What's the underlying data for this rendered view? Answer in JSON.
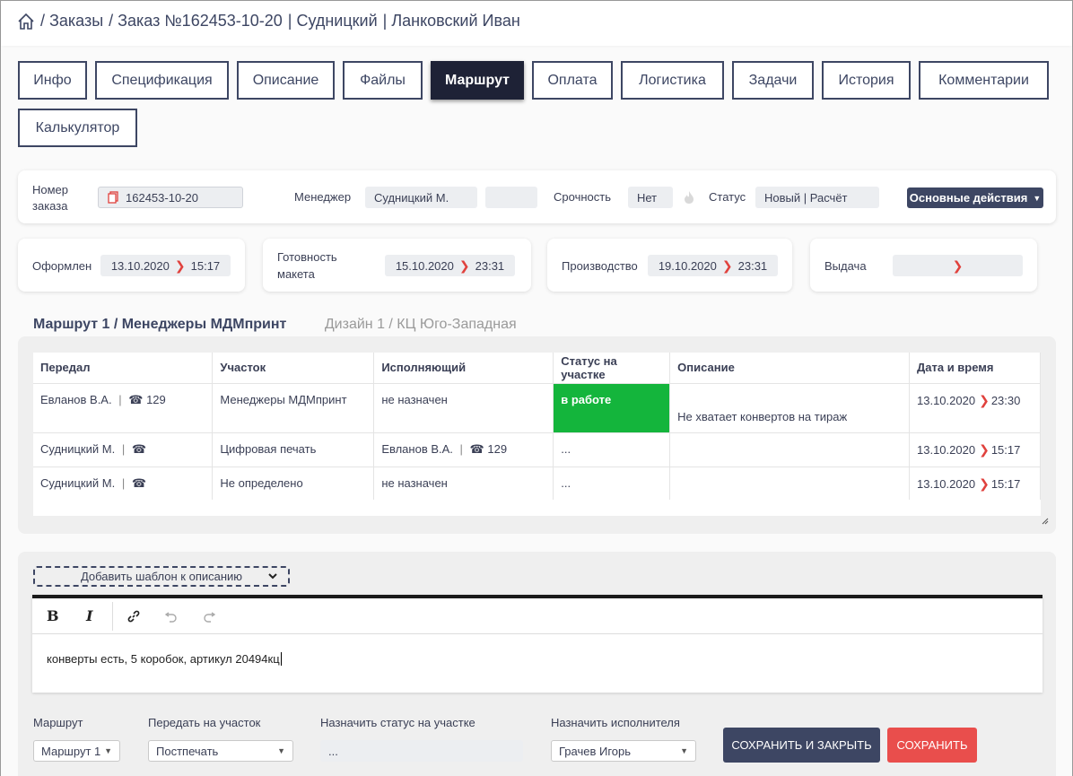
{
  "breadcrumb": {
    "orders": "/ Заказы",
    "order": "/ Заказ №162453-10-20",
    "manager": "| Судницкий",
    "client": "| Ланковский Иван"
  },
  "tabs": [
    "Инфо",
    "Спецификация",
    "Описание",
    "Файлы",
    "Маршрут",
    "Оплата",
    "Логистика",
    "Задачи",
    "История",
    "Комментарии",
    "Калькулятор"
  ],
  "active_tab": "Маршрут",
  "order_info": {
    "number_label": "Номер\nзаказа",
    "number_value": "162453-10-20",
    "manager_label": "Менеджер",
    "manager_value": "Судницкий М.",
    "urgency_label": "Срочность",
    "urgency_value": "Нет",
    "status_label": "Статус",
    "status_value": "Новый | Расчёт",
    "actions_button": "Основные действия"
  },
  "dates": {
    "placed_label": "Оформлен",
    "placed_date": "13.10.2020",
    "placed_time": "15:17",
    "layout_label": "Готовность\nмакета",
    "layout_date": "15.10.2020",
    "layout_time": "23:31",
    "production_label": "Производство",
    "production_date": "19.10.2020",
    "production_time": "23:31",
    "delivery_label": "Выдача"
  },
  "route_tabs": {
    "active": "Маршрут 1 / Менеджеры МДМпринт",
    "inactive": "Дизайн 1 / КЦ Юго-Западная"
  },
  "route_table": {
    "headers": [
      "Передал",
      "Участок",
      "Исполняющий",
      "Статус на участке",
      "Описание",
      "Дата и время"
    ],
    "rows": [
      {
        "from": "Евланов В.А.",
        "from_phone": "129",
        "section": "Менеджеры МДМпринт",
        "executor": "не назначен",
        "executor_phone": "",
        "status": "в работе",
        "description": "Не хватает конвертов на тираж",
        "date": "13.10.2020",
        "time": "23:30"
      },
      {
        "from": "Судницкий М.",
        "from_phone": "",
        "section": "Цифровая печать",
        "executor": "Евланов В.А.",
        "executor_phone": "129",
        "status": "...",
        "description": "",
        "date": "13.10.2020",
        "time": "15:17"
      },
      {
        "from": "Судницкий М.",
        "from_phone": "",
        "section": "Не определено",
        "executor": "не назначен",
        "executor_phone": "",
        "status": "...",
        "description": "",
        "date": "13.10.2020",
        "time": "15:17"
      }
    ]
  },
  "editor": {
    "template_select": "Добавить шаблон к описанию",
    "text": "конверты есть, 5 коробок, артикул 20494кц"
  },
  "form": {
    "route_label": "Маршрут",
    "route_value": "Маршрут 1",
    "pass_label": "Передать на участок",
    "pass_value": "Постпечать",
    "status_label": "Назначить статус на участке",
    "status_value": "...",
    "executor_label": "Назначить исполнителя",
    "executor_value": "Грачев Игорь",
    "save_close": "СОХРАНИТЬ И ЗАКРЫТЬ",
    "save": "СОХРАНИТЬ"
  },
  "colors": {
    "primary": "#3d4663",
    "active_tab": "#1e2236",
    "status_green": "#14b53c",
    "save_red": "#e94e4c",
    "chevron": "#e0413d"
  }
}
